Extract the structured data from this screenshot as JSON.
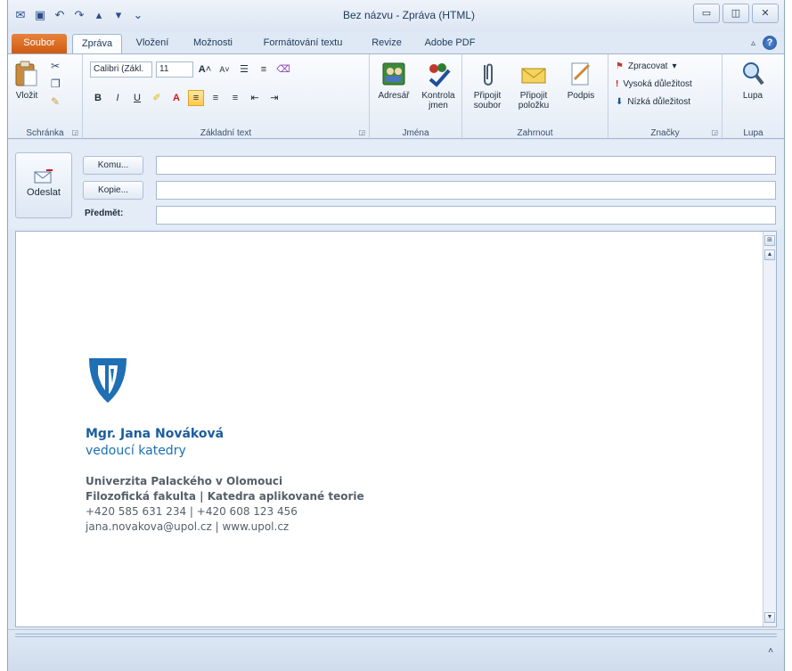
{
  "window": {
    "title": "Bez názvu - Zpráva (HTML)"
  },
  "quick_access": {
    "items": [
      "app-icon",
      "save-icon",
      "undo-icon",
      "redo-icon",
      "up-icon",
      "down-icon",
      "customize-icon"
    ]
  },
  "tabs": [
    {
      "label": "Soubor"
    },
    {
      "label": "Zpráva"
    },
    {
      "label": "Vložení"
    },
    {
      "label": "Možnosti"
    },
    {
      "label": "Formátování textu"
    },
    {
      "label": "Revize"
    },
    {
      "label": "Adobe PDF"
    }
  ],
  "ribbon": {
    "clipboard": {
      "label": "Schránka",
      "paste": "Vložit"
    },
    "basic_text": {
      "label": "Základní text",
      "font_name": "Calibri (Zákl.",
      "font_size": "11",
      "bold": "B",
      "italic": "I",
      "underline": "U"
    },
    "names": {
      "label": "Jména",
      "address_book": "Adresář",
      "check_names": "Kontrola jmen"
    },
    "include": {
      "label": "Zahrnout",
      "attach_file": "Připojit soubor",
      "attach_item": "Připojit položku",
      "signature": "Podpis"
    },
    "tags": {
      "label": "Značky",
      "follow_up": "Zpracovat",
      "high_importance": "Vysoká důležitost",
      "low_importance": "Nízká důležitost"
    },
    "zoom": {
      "label": "Lupa",
      "button": "Lupa"
    }
  },
  "compose": {
    "send": "Odeslat",
    "to_button": "Komu...",
    "cc_button": "Kopie...",
    "subject_label": "Předmět:",
    "to_value": "",
    "cc_value": "",
    "subject_value": ""
  },
  "signature": {
    "name": "Mgr. Jana Nováková",
    "role": "vedoucí katedry",
    "university": "Univerzita Palackého v Olomouci",
    "faculty": "Filozofická fakulta | Katedra aplikované teorie",
    "phones": "+420 585 631 234  | +420 608 123 456",
    "contact": "jana.novakova@upol.cz | www.upol.cz"
  },
  "colors": {
    "accent_blue": "#1b5e9d",
    "file_tab": "#cf5b12",
    "logo_blue": "#1f6fb5"
  }
}
